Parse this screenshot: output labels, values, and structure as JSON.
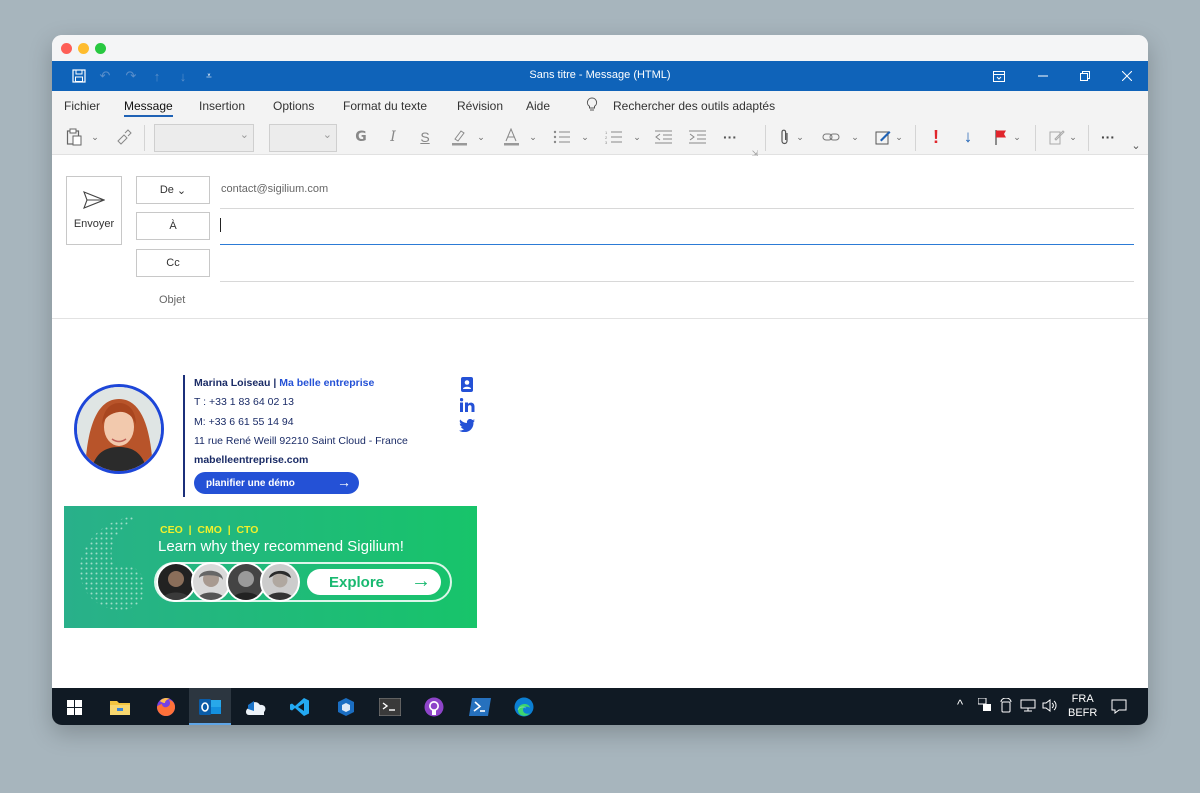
{
  "window": {
    "title": "Sans titre  -  Message (HTML)"
  },
  "menu": {
    "tabs": [
      "Fichier",
      "Message",
      "Insertion",
      "Options",
      "Format du texte",
      "Révision",
      "Aide"
    ],
    "search": "Rechercher des outils adaptés"
  },
  "ribbon": {
    "bold": "G",
    "italic": "I",
    "underline": "S",
    "more": "···",
    "important": "!"
  },
  "compose": {
    "send_label": "Envoyer",
    "from_label": "De",
    "from_value": "contact@sigilium.com",
    "to_label": "À",
    "cc_label": "Cc",
    "subject_label": "Objet"
  },
  "signature": {
    "name": "Marina Loiseau",
    "separator": " | ",
    "company": "Ma belle entreprise",
    "phone": "T : +33 1 83 64 02 13",
    "mobile": "M: +33 6 61 55 14 94",
    "address": "11 rue René Weill 92210 Saint Cloud - France",
    "website": "mabelleentreprise.com",
    "cta": "planifier une démo"
  },
  "banner": {
    "roles": "CEO  |  CMO  |  CTO",
    "headline": "Learn why they recommend Sigilium!",
    "cta": "Explore"
  },
  "taskbar": {
    "lang1": "FRA",
    "lang2": "BEFR"
  },
  "colors": {
    "brand_blue": "#0f63b9",
    "signature_blue": "#2451d6",
    "banner_green": "#17c46a",
    "flag_red": "#e0262c"
  }
}
